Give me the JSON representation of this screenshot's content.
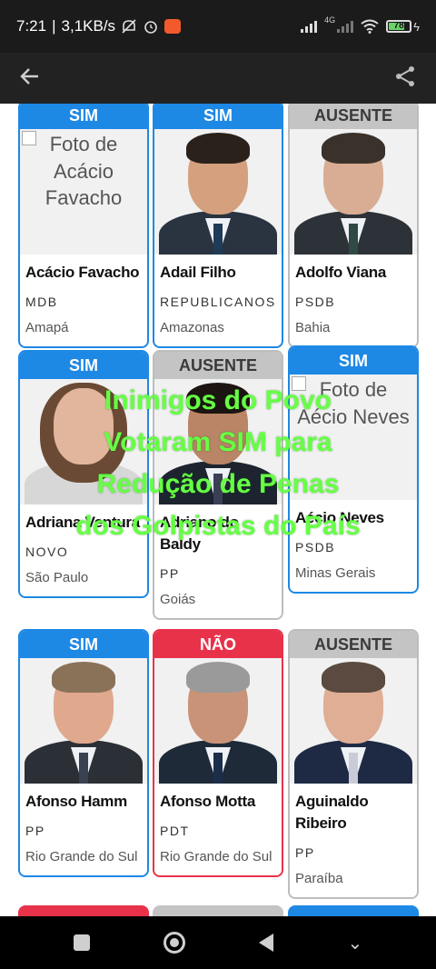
{
  "status_bar": {
    "time": "7:21",
    "net_speed": "3,1KB/s",
    "network": "4G",
    "battery": "78"
  },
  "overlay_lines": [
    "Inimigos do Povo",
    "Votaram SIM para",
    "Redução de Penas",
    "dos Golpistas do País"
  ],
  "deputies": [
    {
      "vote": "SIM",
      "name": "Acácio Favacho",
      "party": "MDB",
      "state": "Amapá",
      "photo_alt": "Foto de Acácio Favacho"
    },
    {
      "vote": "SIM",
      "name": "Adail Filho",
      "party": "REPUBLICANOS",
      "state": "Amazonas"
    },
    {
      "vote": "AUSENTE",
      "name": "Adolfo Viana",
      "party": "PSDB",
      "state": "Bahia"
    },
    {
      "vote": "SIM",
      "name": "Adriana Ventura",
      "party": "NOVO",
      "state": "São Paulo"
    },
    {
      "vote": "AUSENTE",
      "name": "Adriano do Baldy",
      "party": "PP",
      "state": "Goiás"
    },
    {
      "vote": "SIM",
      "name": "Aécio Neves",
      "party": "PSDB",
      "state": "Minas Gerais",
      "photo_alt": "Foto de Aécio Neves"
    },
    {
      "vote": "SIM",
      "name": "Afonso Hamm",
      "party": "PP",
      "state": "Rio Grande do Sul"
    },
    {
      "vote": "NÃO",
      "name": "Afonso Motta",
      "party": "PDT",
      "state": "Rio Grande do Sul"
    },
    {
      "vote": "AUSENTE",
      "name": "Aguinaldo Ribeiro",
      "party": "PP",
      "state": "Paraíba"
    }
  ],
  "colors": {
    "sim": "#1e88e5",
    "nao": "#e8324a",
    "ausente": "#c4c4c4",
    "overlay": "#66ff44"
  }
}
